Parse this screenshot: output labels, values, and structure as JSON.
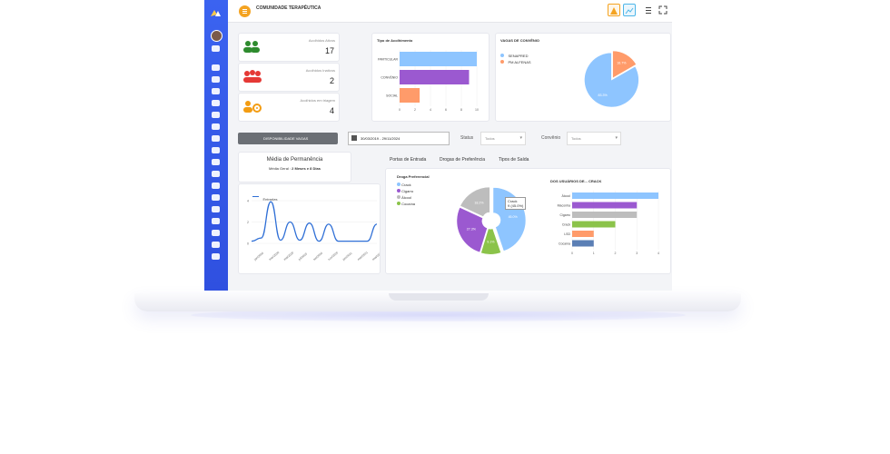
{
  "header": {
    "title": "COMUNIDADE TERAPÊUTICA"
  },
  "stats": [
    {
      "label": "Acolhidos Ativos",
      "value": "17",
      "color": "#2e8b2e"
    },
    {
      "label": "Acolhidos Inativos",
      "value": "2",
      "color": "#e53935"
    },
    {
      "label": "Acolhidos em triagem",
      "value": "4",
      "color": "#f39c12"
    }
  ],
  "tipo_acolhimento": {
    "title": "Tipo de Acolhimento"
  },
  "vagas_convenio": {
    "title": "VAGAS DE CONVÊNIO",
    "legend": [
      "SENAPRED",
      "PM ALFENAS"
    ],
    "slice_labels": [
      "16.7%",
      "83.3%"
    ]
  },
  "filters": {
    "disponibilidade_label": "DISPONIBILIDADE VAGAS",
    "date_range": "30/03/2019 - 29/11/2024",
    "status_label": "Status",
    "status_value": "Todos",
    "convenio_label": "Convênio",
    "convenio_value": "Todos"
  },
  "permanencia": {
    "title": "Média de Permanência",
    "subtitle_prefix": "Média Geral :",
    "subtitle_value": "2 Meses e 8 Dias",
    "legend": "Entradas"
  },
  "tabs": [
    "Portas de Entrada",
    "Drogas de Preferência",
    "Tipos de Saída"
  ],
  "droga_pref": {
    "title": "Droga Preferencial",
    "legend": [
      "Crack",
      "Cigarro",
      "Álcool",
      "Cocaína"
    ],
    "tooltip": "Crack\n9 (45.0%)"
  },
  "usuarios_crack": {
    "title": "DOS USUÁRIOS DE... CRACK"
  },
  "chart_data": [
    {
      "type": "bar",
      "orientation": "horizontal",
      "title": "Tipo de Acolhimento",
      "categories": [
        "PARTICULAR",
        "CONVÊNIO",
        "SOCIAL"
      ],
      "values": [
        10,
        9,
        2.6
      ],
      "colors": [
        "#8ec5ff",
        "#9b59d0",
        "#ff9b6a"
      ],
      "xlim": [
        0,
        10
      ],
      "xticks": [
        "0",
        "2",
        "4",
        "6",
        "8",
        "10"
      ]
    },
    {
      "type": "pie",
      "title": "VAGAS DE CONVÊNIO",
      "labels": [
        "SENAPRED",
        "PM ALFENAS"
      ],
      "values": [
        83.3,
        16.7
      ],
      "colors": [
        "#8ec5ff",
        "#ff9b6a"
      ]
    },
    {
      "type": "line",
      "title": "Média de Permanência",
      "series": [
        {
          "name": "Entradas",
          "values": [
            0.2,
            0.5,
            3.9,
            0.3,
            2.0,
            0.3,
            1.9,
            0.2,
            1.8,
            0.2,
            0.2,
            0.2,
            0.2,
            1.8
          ]
        }
      ],
      "ylim": [
        0,
        4
      ],
      "yticks": [
        "0",
        "2",
        "4"
      ],
      "x_labels": [
        "jan/2020",
        "mar/2020",
        "mai/2020",
        "jul/2020",
        "set/2020",
        "nov/2020",
        "jan/2021",
        "mar/2021",
        "mai/2021"
      ]
    },
    {
      "type": "pie",
      "title": "Droga Preferencial",
      "labels": [
        "Crack",
        "Cocaína",
        "Cigarro",
        "Álcool"
      ],
      "values": [
        45.0,
        10.0,
        27.3,
        18.2
      ],
      "display": [
        "45.0%",
        "9.1%",
        "27.3%",
        "18.2%"
      ],
      "colors": [
        "#8ec5ff",
        "#8bc34a",
        "#9b59d0",
        "#bdbdbd"
      ]
    },
    {
      "type": "bar",
      "orientation": "horizontal",
      "title": "DOS USUÁRIOS DE... CRACK",
      "categories": [
        "Álcool",
        "Maconha",
        "Cigarro",
        "Crack",
        "LSD",
        "Cocaína"
      ],
      "values": [
        4,
        3,
        3,
        2,
        1,
        1
      ],
      "colors": [
        "#8ec5ff",
        "#9b59d0",
        "#bdbdbd",
        "#8bc34a",
        "#ff9b6a",
        "#5b7fb5"
      ],
      "xlim": [
        0,
        4
      ],
      "xticks": [
        "0",
        "1",
        "2",
        "3",
        "4"
      ]
    }
  ]
}
